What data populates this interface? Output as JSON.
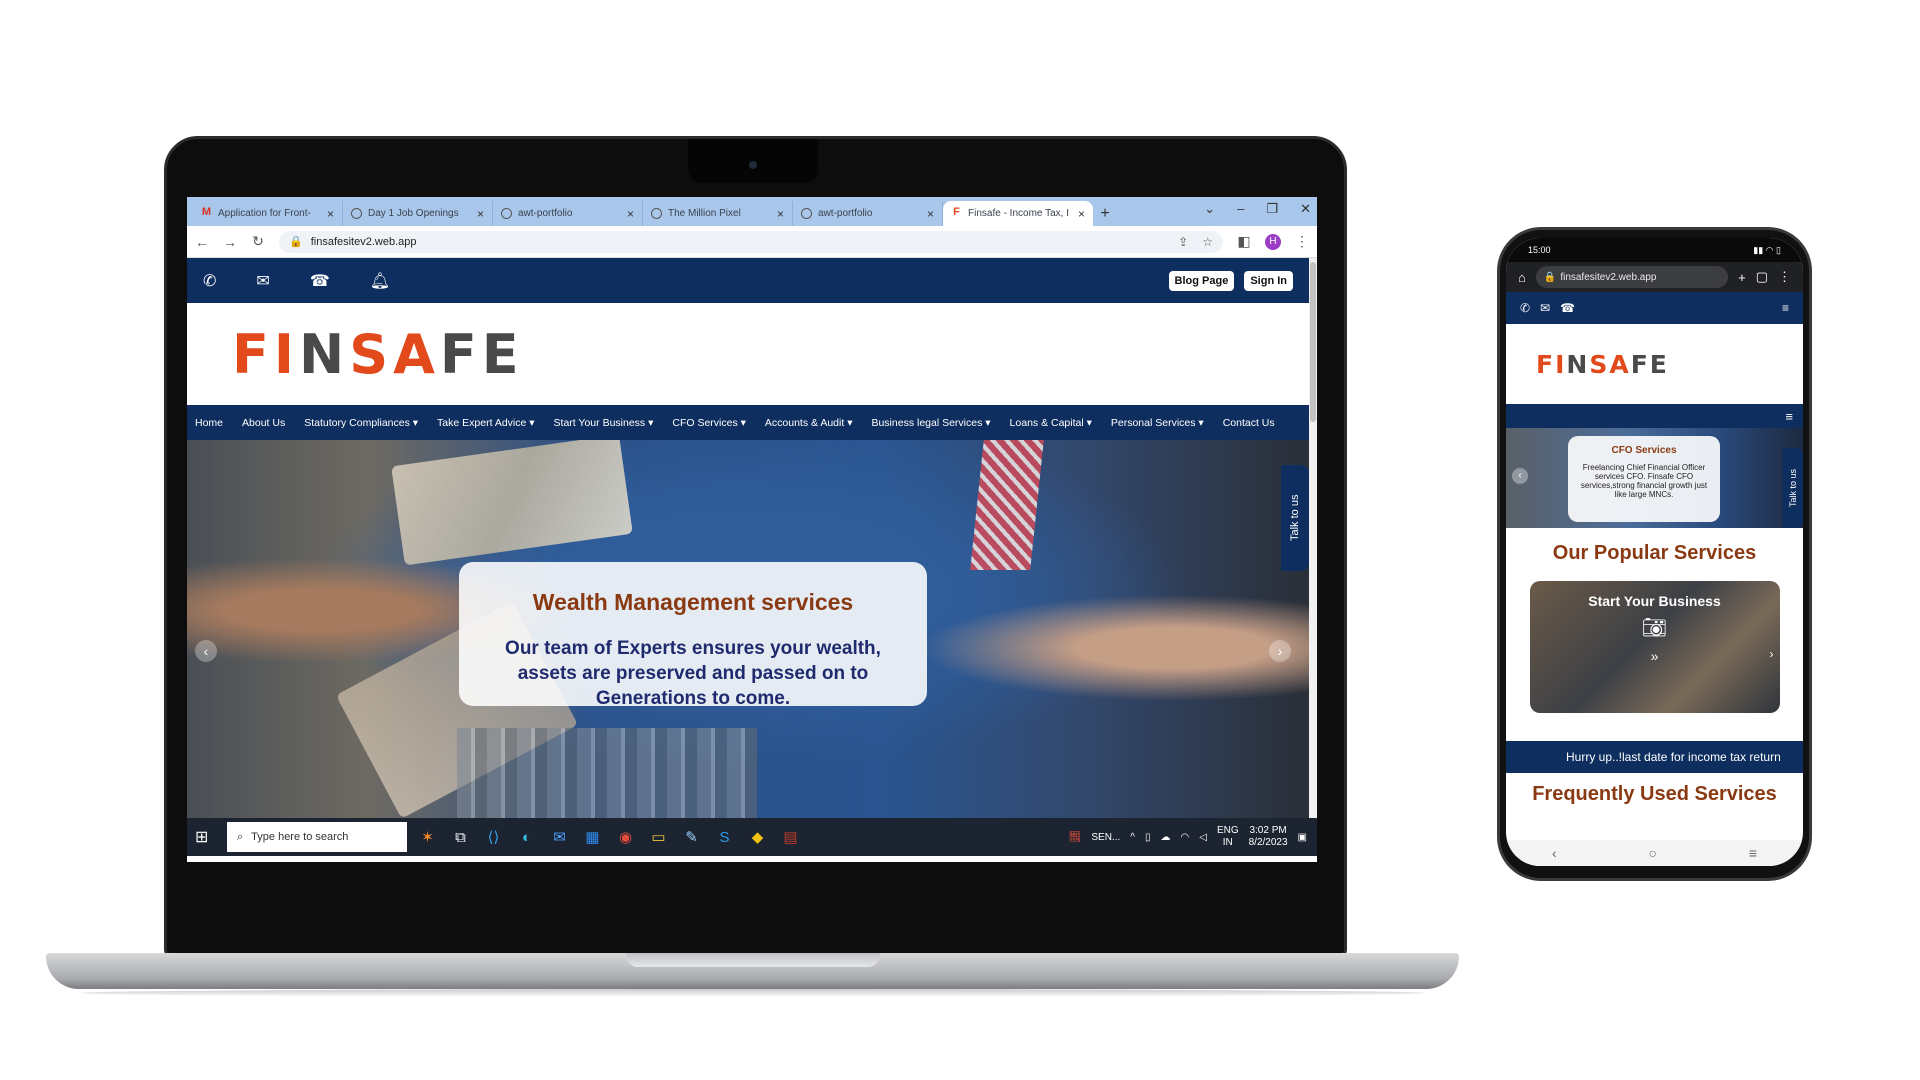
{
  "browser": {
    "tabs": [
      {
        "title": "Application for Front-",
        "icon": "gmail-icon"
      },
      {
        "title": "Day 1 Job Openings",
        "icon": "globe-icon"
      },
      {
        "title": "awt-portfolio",
        "icon": "globe-icon"
      },
      {
        "title": "The Million Pixel",
        "icon": "globe-icon"
      },
      {
        "title": "awt-portfolio",
        "icon": "globe-icon"
      },
      {
        "title": "Finsafe - Income Tax, I",
        "icon": "finsafe-icon",
        "active": true
      }
    ],
    "new_tab": "+",
    "url": "finsafesitev2.web.app",
    "profile_initial": "H"
  },
  "site": {
    "topbar_buttons": {
      "blog": "Blog Page",
      "signin": "Sign In"
    },
    "logo": {
      "part1": "FI",
      "part2": "N",
      "part3": "SA",
      "part4": "F",
      "part5": "E"
    },
    "nav": [
      "Home",
      "About Us",
      "Statutory Compliances ▾",
      "Take Expert Advice ▾",
      "Start Your Business ▾",
      "CFO Services ▾",
      "Accounts & Audit ▾",
      "Business legal Services ▾",
      "Loans & Capital ▾",
      "Personal Services ▾",
      "Contact Us"
    ],
    "hero": {
      "title": "Wealth Management services",
      "text": "Our team of Experts ensures your wealth, assets are preserved and passed on to Generations to come."
    },
    "talk": "Talk to us"
  },
  "taskbar": {
    "search_placeholder": "Type here to search",
    "tray_app": "SEN...",
    "lang": "ENG",
    "region": "IN",
    "time": "3:02 PM",
    "date": "8/2/2023"
  },
  "phone": {
    "status_time": "15:00",
    "url": "finsafesitev2.web.app",
    "hero_card": {
      "title": "CFO Services",
      "text": "Freelancing Chief Financial Officer services CFO. Finsafe CFO services,strong financial growth just like large MNCs."
    },
    "popular_heading": "Our Popular Services",
    "service_title": "Start Your Business",
    "ticker": "Hurry up..!last date for income tax return",
    "frequent_heading": "Frequently Used Services",
    "talk": "Talk to us"
  },
  "colors": {
    "navy": "#0e2e5f",
    "brand_orange": "#e2491b",
    "heading_brown": "#8a3a12"
  }
}
